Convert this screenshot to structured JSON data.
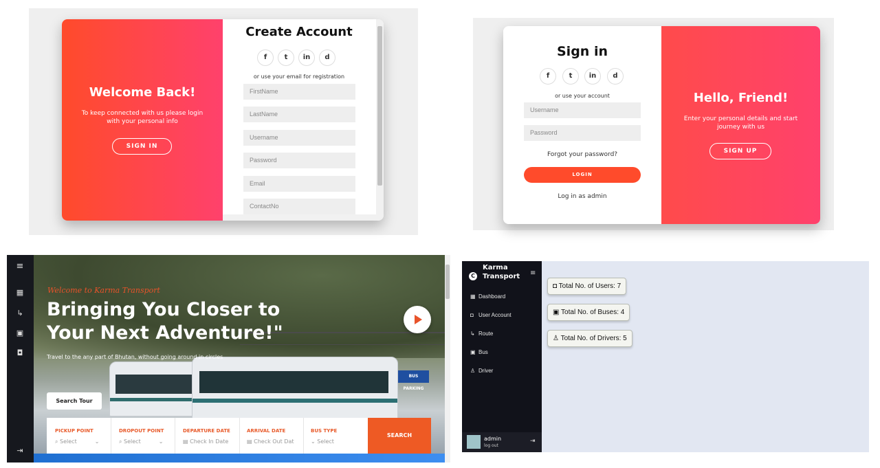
{
  "register_panel": {
    "left_title": "Welcome Back!",
    "left_text": "To keep connected with us please login with your personal info",
    "left_button": "SIGN IN",
    "title": "Create Account",
    "socials": [
      "f",
      "t",
      "in",
      "d"
    ],
    "social_icons": [
      "facebook-icon",
      "twitter-icon",
      "linkedin-icon",
      "discord-icon"
    ],
    "subtitle": "or use your email for registration",
    "fields": [
      "FirstName",
      "LastName",
      "Username",
      "Password",
      "Email",
      "ContactNo"
    ]
  },
  "signin_panel": {
    "title": "Sign in",
    "socials": [
      "f",
      "t",
      "in",
      "d"
    ],
    "subtitle": "or use your account",
    "fields": [
      "Username",
      "Password"
    ],
    "forgot": "Forgot your password?",
    "login_button": "LOGIN",
    "admin_link": "Log in as admin",
    "right_title": "Hello, Friend!",
    "right_text": "Enter your personal details and start journey with us",
    "right_button": "SIGN UP"
  },
  "landing": {
    "tagline": "Welcome to Karma Transport",
    "headline_line1": "Bringing You Closer to",
    "headline_line2": "Your Next Adventure!\"",
    "subtext": "Travel to the any part of Bhutan, without going around in circles",
    "search_tour": "Search Tour",
    "parking_sign": "BUS PARKING",
    "booking": [
      {
        "label": "PICKUP POINT",
        "value": "Select"
      },
      {
        "label": "DROPOUT POINT",
        "value": "Select"
      },
      {
        "label": "DEPARTURE DATE",
        "value": "Check In Date"
      },
      {
        "label": "ARRIVAL DATE",
        "value": "Check Out Dat"
      },
      {
        "label": "BUS TYPE",
        "value": "Select"
      }
    ],
    "search_button": "SEARCH"
  },
  "dashboard": {
    "brand_line1": "Karma",
    "brand_line2": "Transport",
    "nav": [
      "Dashboard",
      "User Account",
      "Route",
      "Bus",
      "Driver"
    ],
    "stats": [
      "Total No. of Users: 7",
      "Total No. of Buses: 4",
      "Total No. of Drivers: 5"
    ],
    "user_name": "admin",
    "user_action": "log out"
  },
  "colors": {
    "accent_orange": "#ff4b2b",
    "accent_pink": "#ff416c",
    "booking_orange": "#ee5a24",
    "dashboard_bg": "#e2e7f2",
    "sidebar_dark": "#11121a"
  }
}
